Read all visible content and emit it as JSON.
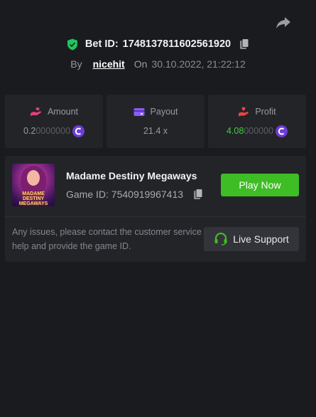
{
  "header": {
    "bet_label": "Bet ID:",
    "bet_id": "1748137811602561920",
    "by_label": "By",
    "username": "nicehit",
    "on_label": "On",
    "datetime": "30.10.2022, 21:22:12"
  },
  "stats": {
    "amount": {
      "label": "Amount",
      "value_main": "0.2",
      "value_trail": "0000000"
    },
    "payout": {
      "label": "Payout",
      "value": "21.4 x"
    },
    "profit": {
      "label": "Profit",
      "value_main": "4.08",
      "value_trail": "000000"
    }
  },
  "game": {
    "thumb_title": "MADAME DESTINY MEGAWAYS",
    "name": "Madame Destiny Megaways",
    "id_label": "Game ID:",
    "id": "7540919967413",
    "play_label": "Play Now"
  },
  "support": {
    "message": "Any issues, please contact the customer service for help and provide the game ID.",
    "button_label": "Live Support"
  },
  "colors": {
    "accent_green": "#3fbd24",
    "coin_purple": "#6e3bd9",
    "profit_green": "#3ecf3a",
    "verified_green": "#22c55e"
  },
  "icons": [
    "share-icon",
    "shield-check-icon",
    "copy-icon",
    "hand-coins-icon",
    "wallet-icon",
    "hand-heart-icon",
    "coin-icon",
    "headset-icon"
  ]
}
